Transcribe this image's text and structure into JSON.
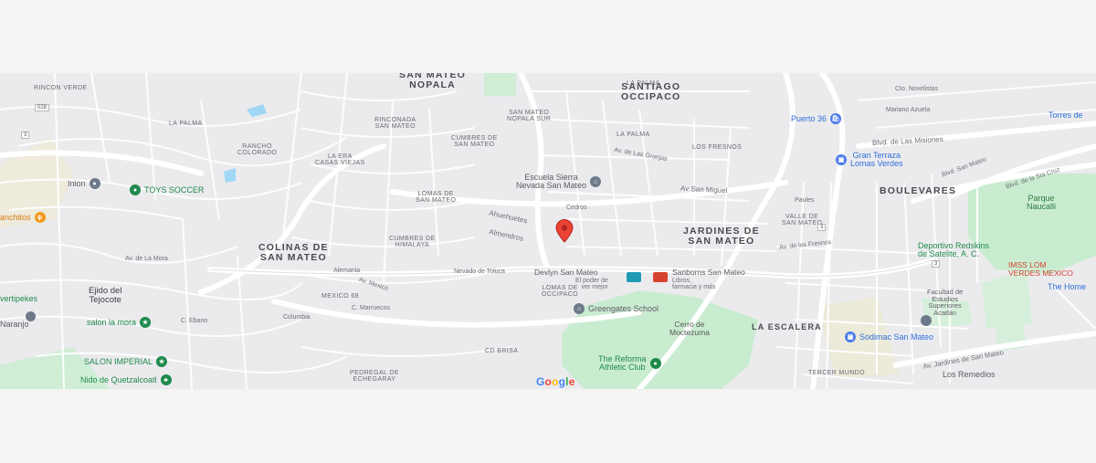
{
  "map": {
    "neighborhoods": [
      {
        "id": "san-mateo-nopala",
        "text": "SAN MATEO\nNOPALA"
      },
      {
        "id": "santiago-occipaco",
        "text": "SANTIAGO\nOCCIPACO"
      },
      {
        "id": "colinas-de-san-mateo",
        "text": "COLINAS DE\nSAN MATEO"
      },
      {
        "id": "jardines-de-san-mateo",
        "text": "JARDINES DE\nSAN MATEO"
      },
      {
        "id": "boulevares",
        "text": "BOULEVARES"
      },
      {
        "id": "la-escalera",
        "text": "LA ESCALERA"
      }
    ],
    "areas": {
      "rincon_verde": "RINCON VERDE",
      "la_palma_w": "LA PALMA",
      "rancho_colorado": "RANCHO\nCOLORADO",
      "la_era": "LA ERA\nCASAS VIEJAS",
      "rinconada": "RINCONADA\nSAN MATEO",
      "cumbres_sm": "CUMBRES DE\nSAN MATEO",
      "san_mateo_nopala_sur": "SAN MATEO\nNOPALA SUR",
      "la_palma_n": "LA PALMA",
      "la_palma_e": "LA PALMA",
      "los_fresnos": "LOS FRESNOS",
      "lomas_sm": "LOMAS DE\nSAN MATEO",
      "cumbres_himalaya": "CUMBRES DE\nHIMALAYA",
      "mexico68": "MEXICO 68",
      "lomas_occipaco": "LOMAS DE\nOCCIPACO",
      "valle_sm": "VALLE DE\nSAN MATEO",
      "cd_brisa": "CD BRISA",
      "pedregal": "PEDREGAL DE\nECHEGARAY",
      "tercer_mundo": "TERCER MUNDO",
      "ejido": "Ejido del\nTejocote",
      "naranjo": "Naranjo",
      "los_remedios": "Los Remedios"
    },
    "streets": {
      "av_san_miguel": "Av San Miguel",
      "ahuehuetes": "Ahuehuetes",
      "almendros": "Almendros",
      "cedros": "Cedros",
      "nevado": "Nevado de Toluca",
      "av_mexico": "Av. Mexico",
      "av_la_mora": "Av. de La Mora",
      "blvd_misiones": "Blvd. de Las Misiones",
      "blvd_san_mateo": "Blvd. San Mateo",
      "blvd_sta_cruz": "Blvd. de la Sta Cruz",
      "av_jardines": "Av. Jardines de San Mateo",
      "av_los_fresnos": "Av. de los Fresnos",
      "av_las_granjas": "Av. de Las Granjas",
      "mariano_azuela": "Mariano Azuela",
      "cto_novelistas": "Cto. Novelistas",
      "columbia": "Columbia",
      "c_ebano": "C. Ebano",
      "c_marrocos": "C. Marruecos",
      "paules": "Paules",
      "alemania": "Alemania"
    },
    "pois": {
      "puerto36": "Puerto 36",
      "gran_terraza": "Gran Terraza\nLomas Verdes",
      "torres": "Torres de",
      "escuela": "Escuela Sierra\nNevada San Mateo",
      "toys": "TOYS SOCCER",
      "inion": "Inion",
      "ranchitos": "anchitos",
      "devlyn": "Devlyn San Mateo",
      "devlyn_sub": "El poder de\nver mejor",
      "sanborns": "Sanborns San Mateo",
      "sanborns_sub": "Libros,\nfarmacia y más",
      "greengates": "Greengates School",
      "cerro": "Cerro de\nMoctezuma",
      "reforma": "The Reforma\nAthletic Club",
      "parque": "Parque\nNaucalli",
      "redskins": "Deportivo Redskins\nde Satelite, A. C.",
      "imss": "IMSS LOM\nVERDES MEXICO",
      "the_home": "The Home",
      "facultad": "Facultad de\nEstudios\nSuperiores\nAcatlán",
      "sodimac": "Sodimac San Mateo",
      "salon_mora": "salon la mora",
      "salon_imperial": "SALON IMPERIAL",
      "nido": "Nido de Quetzalcoatl",
      "vertipekes": "vertipekes"
    },
    "google": "Google",
    "colors": {
      "park": "#c9ecd0",
      "water": "#9fd7f5",
      "road": "#ffffff",
      "pin": "#ea4335"
    }
  }
}
